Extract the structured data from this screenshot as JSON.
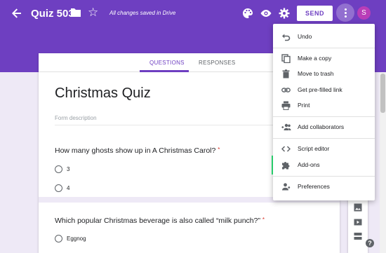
{
  "header": {
    "title": "Quiz 503",
    "saved_status": "All changes saved in Drive",
    "send_label": "SEND",
    "avatar_letter": "S",
    "accent_color": "#6e3fc1"
  },
  "tabs": {
    "questions": "QUESTIONS",
    "responses": "RESPONSES"
  },
  "form": {
    "title": "Christmas Quiz",
    "description_placeholder": "Form description",
    "questions": [
      {
        "text": "How many ghosts show up in A Christmas Carol?",
        "required_mark": "*",
        "options": [
          "3",
          "4"
        ]
      },
      {
        "text": "Which popular Christmas beverage is also called “milk punch?”",
        "required_mark": "*",
        "options": [
          "Eggnog"
        ]
      }
    ]
  },
  "menu": {
    "items": [
      {
        "label": "Undo",
        "icon": "undo-icon"
      },
      {
        "label": "Make a copy",
        "icon": "copy-icon"
      },
      {
        "label": "Move to trash",
        "icon": "trash-icon"
      },
      {
        "label": "Get pre-filled link",
        "icon": "link-icon"
      },
      {
        "label": "Print",
        "icon": "print-icon"
      },
      {
        "label": "Add collaborators",
        "icon": "add-people-icon"
      },
      {
        "label": "Script editor",
        "icon": "code-icon"
      },
      {
        "label": "Add-ons",
        "icon": "puzzle-icon"
      },
      {
        "label": "Preferences",
        "icon": "person-icon"
      }
    ]
  },
  "help_label": "?"
}
